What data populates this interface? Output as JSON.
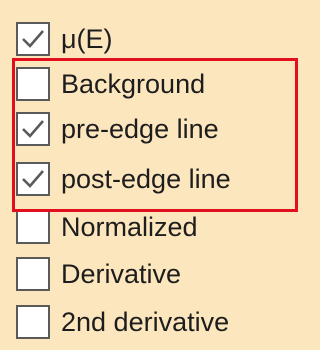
{
  "options": [
    {
      "label": "μ(E)",
      "checked": true
    },
    {
      "label": "Background",
      "checked": false
    },
    {
      "label": "pre-edge line",
      "checked": true
    },
    {
      "label": "post-edge line",
      "checked": true
    },
    {
      "label": "Normalized",
      "checked": false
    },
    {
      "label": "Derivative",
      "checked": false
    },
    {
      "label": "2nd derivative",
      "checked": false
    }
  ],
  "colors": {
    "background": "#FCE6BE",
    "highlight_border": "#E2101F",
    "check_mark": "#5a5a5a"
  }
}
